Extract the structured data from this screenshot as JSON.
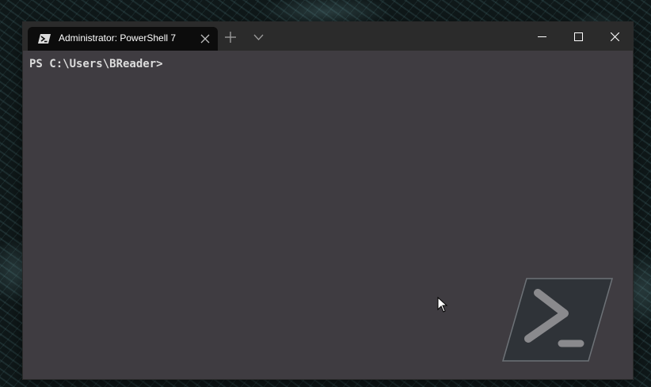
{
  "window": {
    "tab_title": "Administrator: PowerShell 7",
    "tab_icon": "powershell-icon"
  },
  "titlebar": {
    "new_tab_icon": "plus-icon",
    "dropdown_icon": "chevron-down-icon",
    "minimize_icon": "minimize-icon",
    "maximize_icon": "maximize-icon",
    "close_icon": "close-icon"
  },
  "terminal": {
    "prompt": "PS C:\\Users\\BReader>",
    "background_color": "#3f3c41",
    "text_color": "#dcdcdc"
  },
  "colors": {
    "titlebar": "#2b2b2b",
    "active_tab": "#0c0c0c"
  }
}
